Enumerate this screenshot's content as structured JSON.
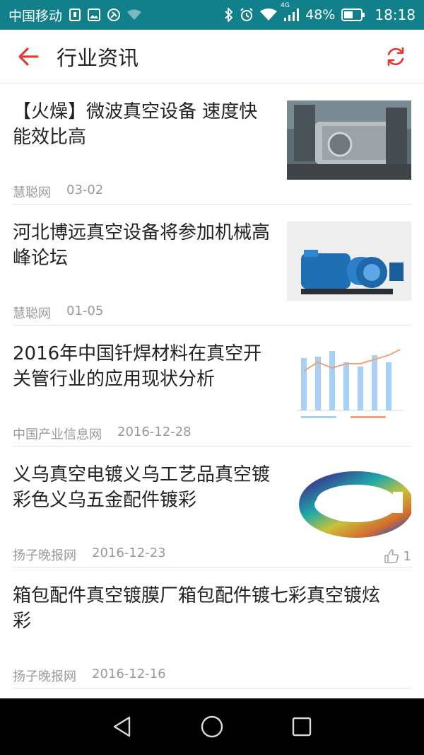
{
  "status_bar": {
    "carrier": "中国移动",
    "network": "4G",
    "battery_percent": "48%",
    "time": "18:18"
  },
  "header": {
    "title": "行业资讯",
    "accent_color": "#e53935"
  },
  "news": [
    {
      "title": "【火燥】微波真空设备 速度快能效比高",
      "source": "慧聪网",
      "date": "03-02"
    },
    {
      "title": "河北博远真空设备将参加机械高峰论坛",
      "source": "慧聪网",
      "date": "01-05"
    },
    {
      "title": "2016年中国钎焊材料在真空开关管行业的应用现状分析",
      "source": "中国产业信息网",
      "date": "2016-12-28"
    },
    {
      "title": "义乌真空电镀义乌工艺品真空镀彩色义乌五金配件镀彩",
      "source": "扬子晚报网",
      "date": "2016-12-23",
      "likes": "1"
    },
    {
      "title": "箱包配件真空镀膜厂箱包配件镀七彩真空镀炫彩",
      "source": "扬子晚报网",
      "date": "2016-12-16"
    }
  ]
}
